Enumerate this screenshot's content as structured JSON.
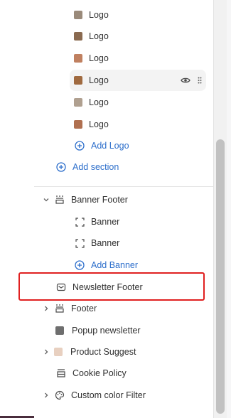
{
  "sections": {
    "logo_items": [
      {
        "label": "Logo",
        "thumb_color": "#9a8a7a"
      },
      {
        "label": "Logo",
        "thumb_color": "#8a6a50"
      },
      {
        "label": "Logo",
        "thumb_color": "#c08060"
      },
      {
        "label": "Logo",
        "thumb_color": "#a06a40"
      },
      {
        "label": "Logo",
        "thumb_color": "#b0a090"
      },
      {
        "label": "Logo",
        "thumb_color": "#b07050"
      }
    ],
    "add_logo_label": "Add Logo",
    "add_section_label": "Add section",
    "banner_footer": {
      "label": "Banner Footer",
      "items": [
        "Banner",
        "Banner"
      ],
      "add_banner_label": "Add Banner"
    },
    "newsletter_footer_label": "Newsletter Footer",
    "footer_label": "Footer",
    "popup_newsletter_label": "Popup newsletter",
    "product_suggest_label": "Product Suggest",
    "cookie_policy_label": "Cookie Policy",
    "custom_color_filter_label": "Custom color Filter"
  },
  "colors": {
    "accent": "#2c6ecb",
    "highlight_box": "#e02020"
  }
}
